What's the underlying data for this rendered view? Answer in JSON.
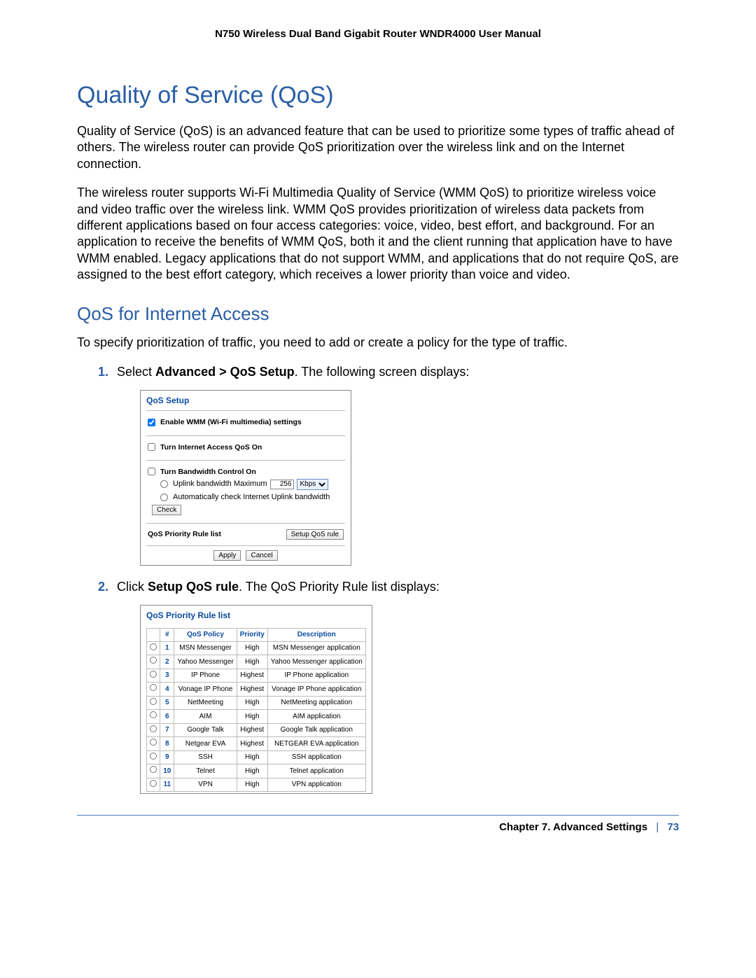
{
  "header": "N750 Wireless Dual Band Gigabit Router WNDR4000 User Manual",
  "title": "Quality of Service (QoS)",
  "para1": "Quality of Service (QoS) is an advanced feature that can be used to prioritize some types of traffic ahead of others. The wireless router can provide QoS prioritization over the wireless link and on the Internet connection.",
  "para2": "The wireless router supports Wi-Fi Multimedia Quality of Service (WMM QoS) to prioritize wireless voice and video traffic over the wireless link. WMM QoS provides prioritization of wireless data packets from different applications based on four access categories: voice, video, best effort, and background. For an application to receive the benefits of WMM QoS, both it and the client running that application have to have WMM enabled. Legacy applications that do not support WMM, and applications that do not require QoS, are assigned to the best effort category, which receives a lower priority than voice and video.",
  "subsection": "QoS for Internet Access",
  "para3": "To specify prioritization of traffic, you need to add or create a policy for the type of traffic.",
  "step1": {
    "num": "1.",
    "pre": "Select ",
    "bold": "Advanced > QoS Setup",
    "post": ". The following screen displays:"
  },
  "panel": {
    "title": "QoS Setup",
    "chk_wmm_label": "Enable WMM (Wi-Fi multimedia) settings",
    "chk_internet_label": "Turn Internet Access QoS On",
    "chk_bw_label": "Turn Bandwidth Control On",
    "radio_uplink_label": "Uplink bandwidth Maximum",
    "uplink_value": "256",
    "uplink_unit": "Kbps",
    "radio_auto_label": "Automatically check Internet Uplink bandwidth",
    "check_btn": "Check",
    "priority_label": "QoS Priority Rule list",
    "setup_btn": "Setup QoS rule",
    "apply_btn": "Apply",
    "cancel_btn": "Cancel"
  },
  "step2": {
    "num": "2.",
    "pre": "Click ",
    "bold": "Setup QoS rule",
    "post": ". The QoS Priority Rule list displays:"
  },
  "rulepanel": {
    "title": "QoS Priority Rule list",
    "headers": {
      "num": "#",
      "policy": "QoS Policy",
      "priority": "Priority",
      "desc": "Description"
    },
    "rows": [
      {
        "n": "1",
        "policy": "MSN Messenger",
        "priority": "High",
        "desc": "MSN Messenger application"
      },
      {
        "n": "2",
        "policy": "Yahoo Messenger",
        "priority": "High",
        "desc": "Yahoo Messenger application"
      },
      {
        "n": "3",
        "policy": "IP Phone",
        "priority": "Highest",
        "desc": "IP Phone application"
      },
      {
        "n": "4",
        "policy": "Vonage IP Phone",
        "priority": "Highest",
        "desc": "Vonage IP Phone application"
      },
      {
        "n": "5",
        "policy": "NetMeeting",
        "priority": "High",
        "desc": "NetMeeting application"
      },
      {
        "n": "6",
        "policy": "AIM",
        "priority": "High",
        "desc": "AIM application"
      },
      {
        "n": "7",
        "policy": "Google Talk",
        "priority": "Highest",
        "desc": "Google Talk application"
      },
      {
        "n": "8",
        "policy": "Netgear EVA",
        "priority": "Highest",
        "desc": "NETGEAR EVA application"
      },
      {
        "n": "9",
        "policy": "SSH",
        "priority": "High",
        "desc": "SSH application"
      },
      {
        "n": "10",
        "policy": "Telnet",
        "priority": "High",
        "desc": "Telnet application"
      },
      {
        "n": "11",
        "policy": "VPN",
        "priority": "High",
        "desc": "VPN application"
      }
    ]
  },
  "footer": {
    "chapter": "Chapter 7.  Advanced Settings",
    "sep": "|",
    "page": "73"
  }
}
